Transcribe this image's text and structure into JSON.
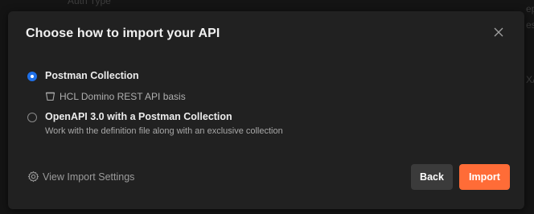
{
  "background": {
    "top_text": "Auth Type",
    "right_text_1": "ep",
    "right_text_2": "es",
    "right_text_3": "XA"
  },
  "dialog": {
    "title": "Choose how to import your API",
    "close_icon": "close-icon",
    "options": [
      {
        "label": "Postman Collection",
        "selected": true,
        "sub_item": {
          "icon": "collection-icon",
          "text": "HCL Domino REST API basis"
        }
      },
      {
        "label": "OpenAPI 3.0 with a Postman Collection",
        "selected": false,
        "description": "Work with the definition file along with an exclusive collection"
      }
    ],
    "settings_link": {
      "icon": "gear-icon",
      "label": "View Import Settings"
    },
    "buttons": {
      "back_label": "Back",
      "import_label": "Import"
    },
    "colors": {
      "primary": "#ff6c37",
      "radio_selected": "#1f70e8",
      "dialog_bg": "#212121"
    }
  }
}
